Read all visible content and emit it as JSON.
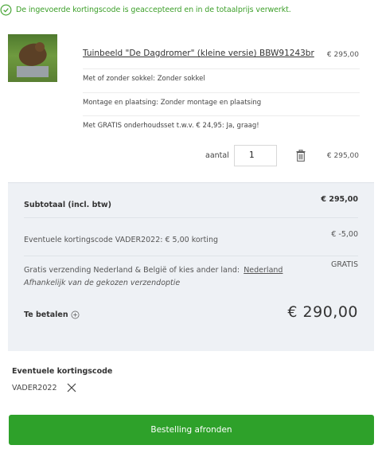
{
  "notice": {
    "text": "De ingevoerde kortingscode is geaccepteerd en in de totaalprijs verwerkt.",
    "color": "#3ea02b"
  },
  "cart_item": {
    "title": "Tuinbeeld \"De Dagdromer\" (kleine versie) BBW91243br",
    "price": "€ 295,00",
    "options": [
      "Met of zonder sokkel: Zonder sokkel",
      "Montage en plaatsing: Zonder montage en plaatsing",
      "Met GRATIS onderhoudsset t.w.v. € 24,95: Ja, graag!"
    ],
    "quantity_label": "aantal",
    "quantity_value": "1",
    "line_total": "€ 295,00"
  },
  "summary": {
    "subtotal_label": "Subtotaal (incl. btw)",
    "subtotal_value": "€ 295,00",
    "discount_label": "Eventuele kortingscode VADER2022: € 5,00 korting",
    "discount_value": "€ -5,00",
    "shipping_label": "Gratis verzending Nederland & België of kies ander land:",
    "shipping_country": "Nederland",
    "shipping_value": "GRATIS",
    "shipping_note": "Afhankelijk van de gekozen verzendoptie",
    "total_label": "Te betalen",
    "total_value": "€ 290,00"
  },
  "coupon": {
    "title": "Eventuele kortingscode",
    "code": "VADER2022"
  },
  "checkout": {
    "label": "Bestelling afronden",
    "color": "#2ea12a"
  },
  "icons": [
    "check-circle-icon",
    "trash-icon",
    "plus-circle-icon",
    "close-icon"
  ]
}
